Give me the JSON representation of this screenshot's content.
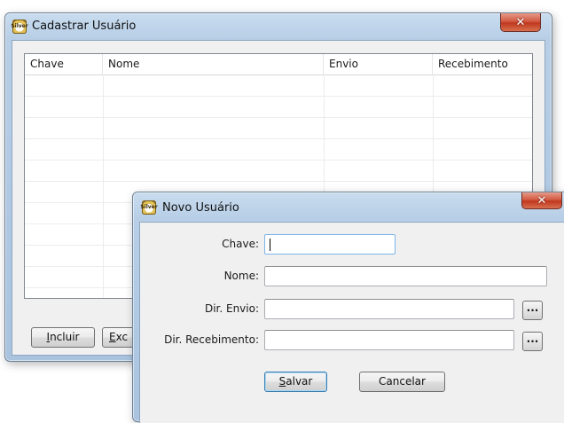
{
  "main_window": {
    "title": "Cadastrar Usuário",
    "icon": "app-logo-icon",
    "icon_text": "Silver",
    "close_glyph": "✕",
    "table": {
      "columns": [
        "Chave",
        "Nome",
        "Envio",
        "Recebimento"
      ],
      "rows": []
    },
    "buttons": {
      "incluir": {
        "underline": "I",
        "rest": "ncluir"
      },
      "excluir": {
        "underline": "E",
        "rest": "xc"
      }
    }
  },
  "dialog": {
    "title": "Novo Usuário",
    "icon": "app-logo-icon",
    "icon_text": "Silver",
    "close_glyph": "✕",
    "fields": {
      "chave": {
        "label": "Chave:",
        "value": ""
      },
      "nome": {
        "label": "Nome:",
        "value": ""
      },
      "dir_envio": {
        "label": "Dir. Envio:",
        "value": "",
        "browse": "..."
      },
      "dir_recebimento": {
        "label": "Dir. Recebimento:",
        "value": "",
        "browse": "..."
      }
    },
    "buttons": {
      "salvar": {
        "underline": "S",
        "rest": "alvar"
      },
      "cancelar": "Cancelar"
    }
  },
  "colors": {
    "title_glass": "#b7cee6",
    "close_red": "#c0381f",
    "client_bg": "#f0f0f0"
  }
}
